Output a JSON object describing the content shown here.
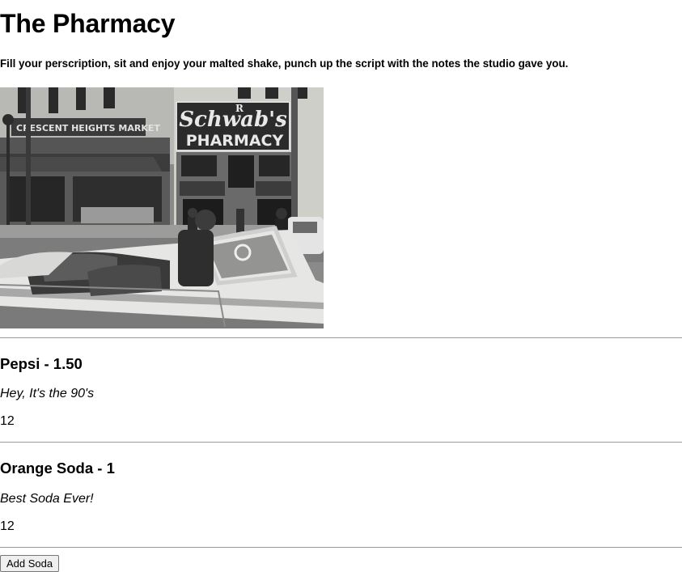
{
  "page": {
    "title": "The Pharmacy",
    "subtitle": "Fill your perscription, sit and enjoy your malted shake, punch up the script with the notes the studio gave you."
  },
  "hero_image": {
    "description": "black-and-white-street-photo",
    "sign_pharmacy": "PHARMACY",
    "sign_script": "Schwab's",
    "sign_market": "CRESCENT HEIGHTS MARKET",
    "sign_rx": "R"
  },
  "sodas": [
    {
      "name_price": "Pepsi - 1.50",
      "description": "Hey, It's the 90's",
      "quantity": "12"
    },
    {
      "name_price": "Orange Soda - 1",
      "description": "Best Soda Ever!",
      "quantity": "12"
    }
  ],
  "actions": {
    "add_soda_label": "Add Soda"
  }
}
